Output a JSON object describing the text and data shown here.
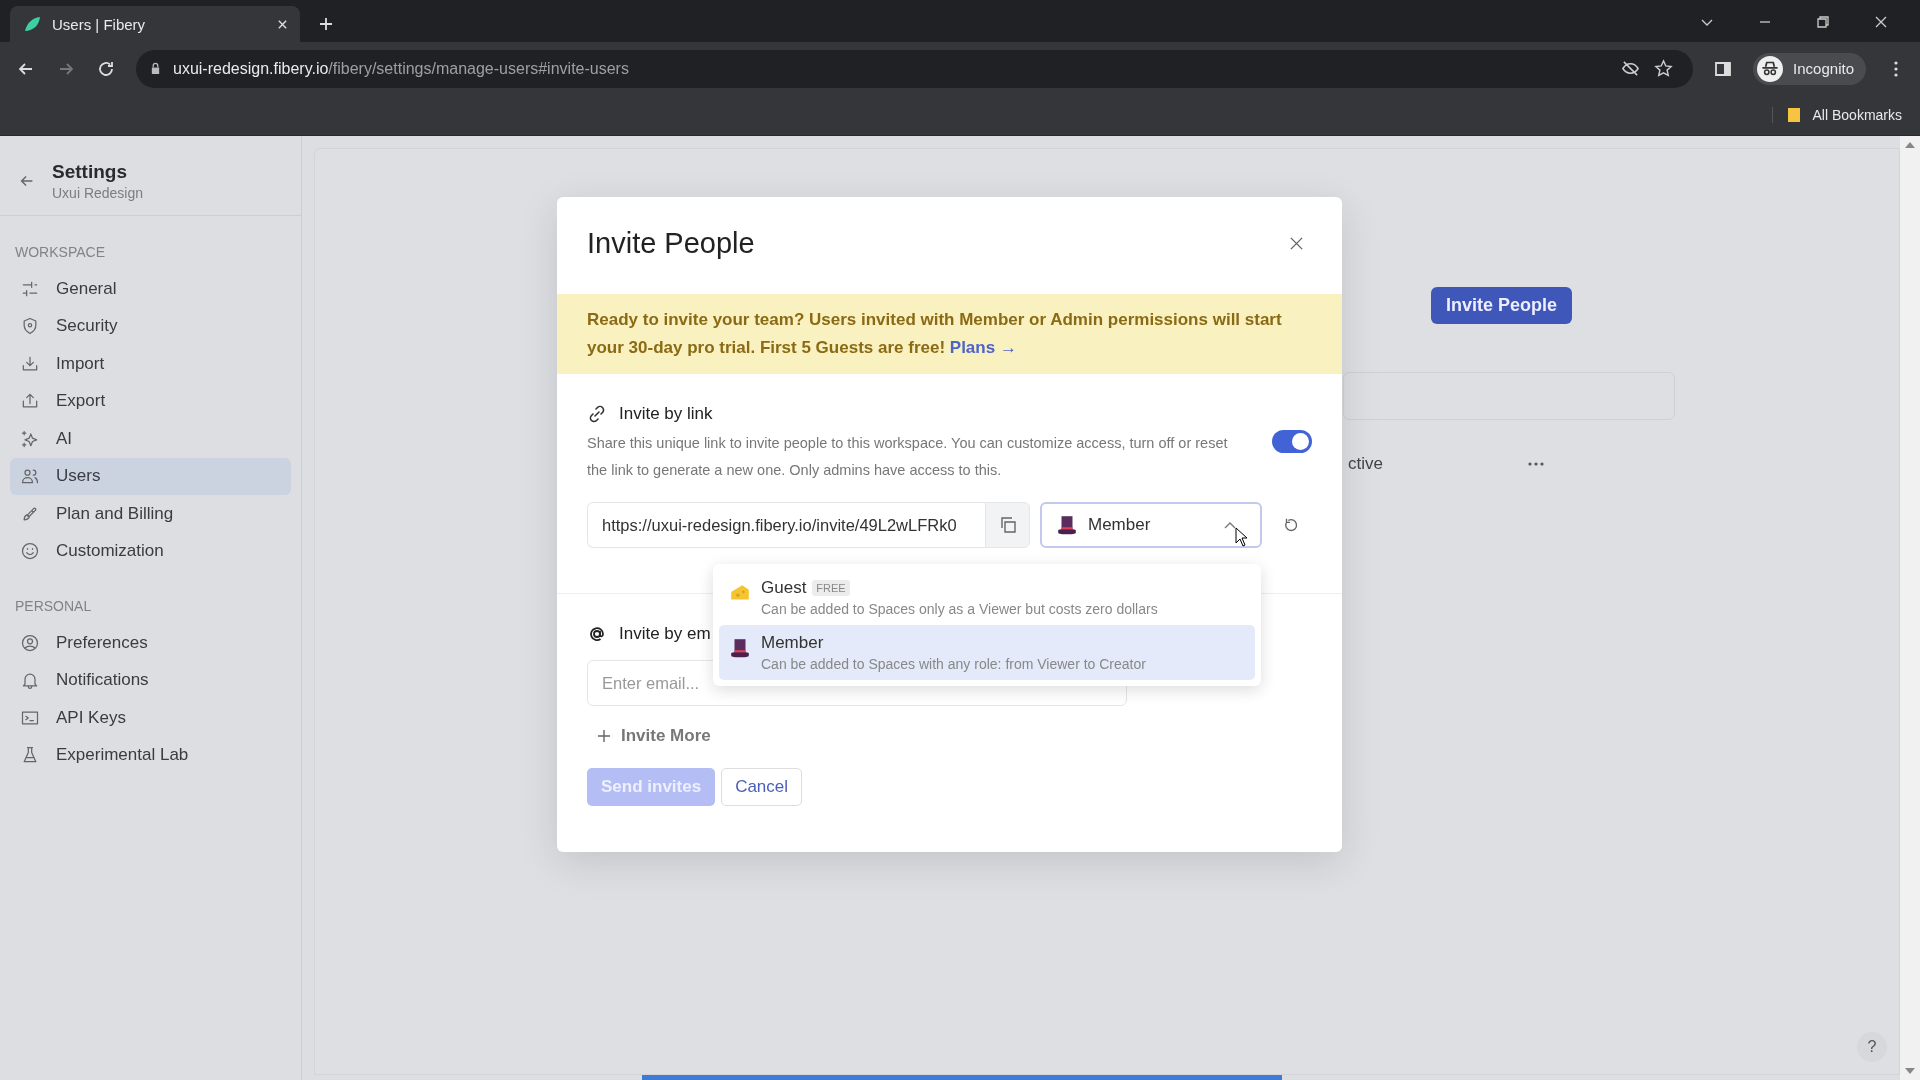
{
  "browser": {
    "tab_title": "Users | Fibery",
    "url_host": "uxui-redesign.fibery.io",
    "url_path": "/fibery/settings/manage-users#invite-users",
    "profile": "Incognito",
    "bookmarks": "All Bookmarks"
  },
  "sidebar": {
    "title": "Settings",
    "subtitle": "Uxui Redesign",
    "sections": [
      {
        "heading": "WORKSPACE",
        "items": [
          {
            "label": "General",
            "selected": false
          },
          {
            "label": "Security",
            "selected": false
          },
          {
            "label": "Import",
            "selected": false
          },
          {
            "label": "Export",
            "selected": false
          },
          {
            "label": "AI",
            "selected": false
          },
          {
            "label": "Users",
            "selected": true
          },
          {
            "label": "Plan and Billing",
            "selected": false
          },
          {
            "label": "Customization",
            "selected": false
          }
        ]
      },
      {
        "heading": "PERSONAL",
        "items": [
          {
            "label": "Preferences",
            "selected": false
          },
          {
            "label": "Notifications",
            "selected": false
          },
          {
            "label": "API Keys",
            "selected": false
          },
          {
            "label": "Experimental Lab",
            "selected": false
          }
        ]
      }
    ]
  },
  "page": {
    "invite_button": "Invite People",
    "row_status": "ctive"
  },
  "modal": {
    "title": "Invite People",
    "banner": {
      "text": "Ready to invite your team? Users invited with Member or Admin permissions will start your 30-day pro trial. First 5 Guests are free!",
      "link": "Plans →"
    },
    "link_section": {
      "heading": "Invite by link",
      "description": "Share this unique link to invite people to this workspace. You can customize access, turn off or reset the link to generate a new one. Only admins have access to this.",
      "on": true,
      "url": "https://uxui-redesign.fibery.io/invite/49L2wLFRk0",
      "role": "Member",
      "expanded": true
    },
    "roles": [
      {
        "name": "Guest",
        "badge": "FREE",
        "description": "Can be added to Spaces only as a Viewer but costs zero dollars",
        "selected": false
      },
      {
        "name": "Member",
        "description": "Can be added to Spaces with any role: from Viewer to Creator",
        "selected": true
      }
    ],
    "email_section": {
      "heading": "Invite by em",
      "placeholder": "Enter email..."
    },
    "invite_more": "Invite More",
    "send": "Send invites",
    "send_disabled": true,
    "cancel": "Cancel"
  },
  "help": "?"
}
